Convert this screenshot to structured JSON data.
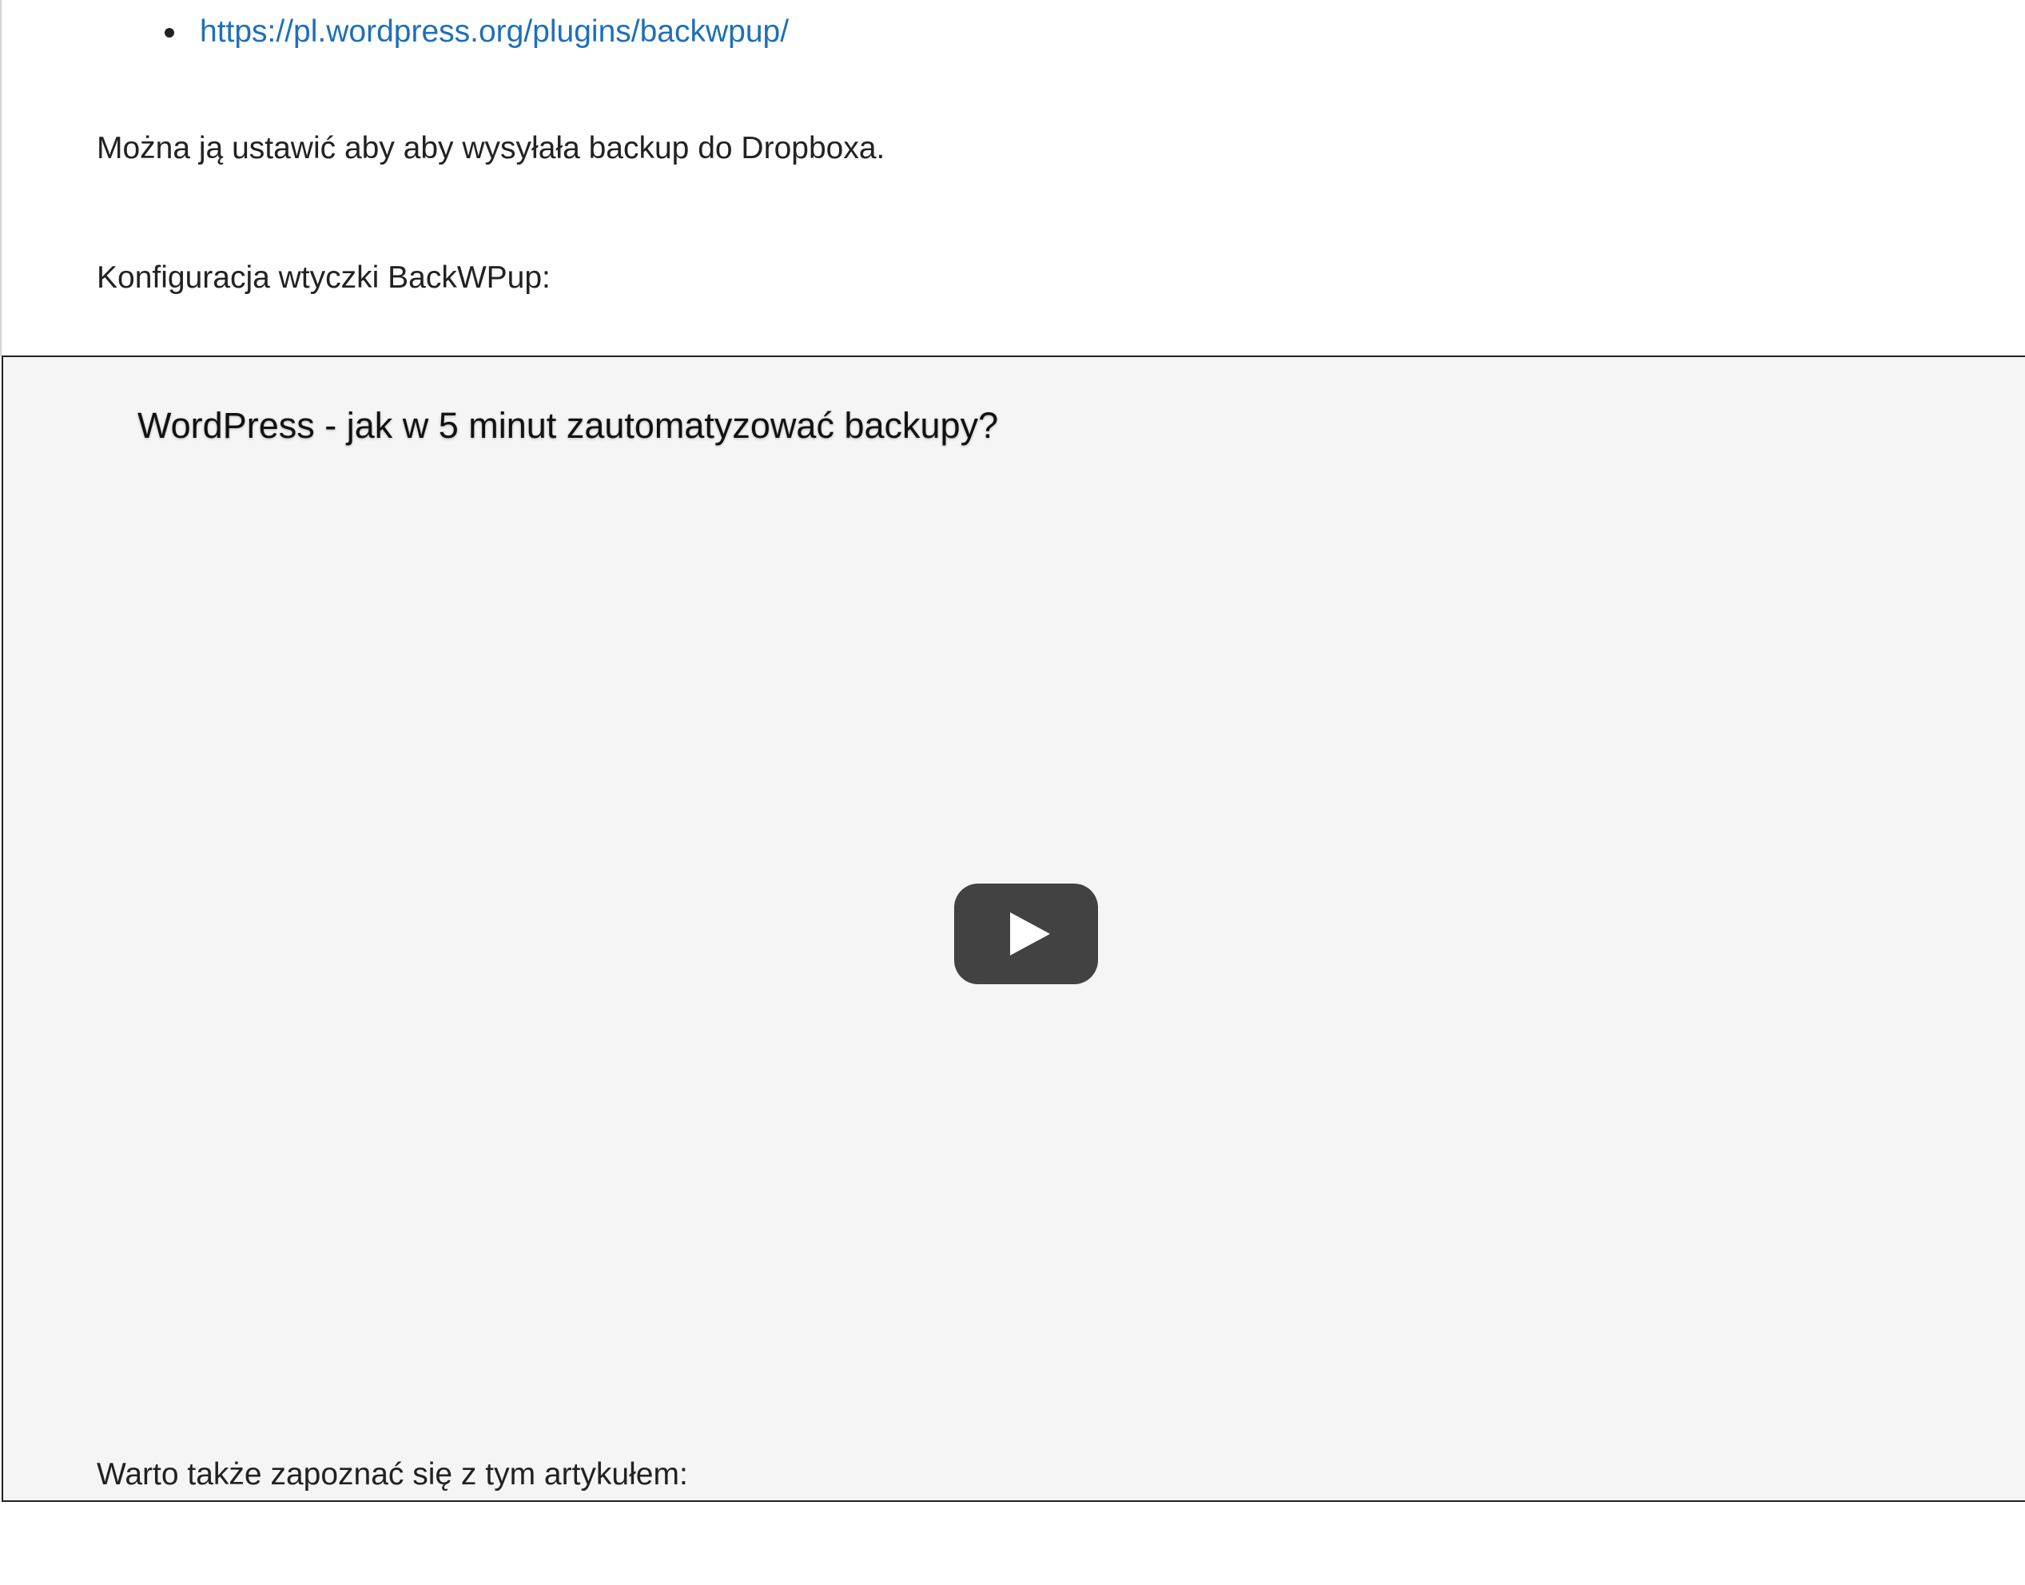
{
  "links": [
    {
      "label": "https://pl.wordpress.org/plugins/backwpup/"
    }
  ],
  "paragraphs": {
    "dropbox_note": "Można ją ustawić aby aby wysyłała backup do Dropboxa.",
    "config_intro": "Konfiguracja wtyczki BackWPup:",
    "article_intro": "Warto także zapoznać się z tym artykułem:"
  },
  "video": {
    "title": "WordPress - jak w 5 minut zautomatyzować backupy?",
    "play_icon": "play-icon",
    "background_color": "#f5f5f5",
    "play_button_color": "#424242"
  },
  "colors": {
    "link": "#1f6fb7",
    "text": "#222222"
  }
}
